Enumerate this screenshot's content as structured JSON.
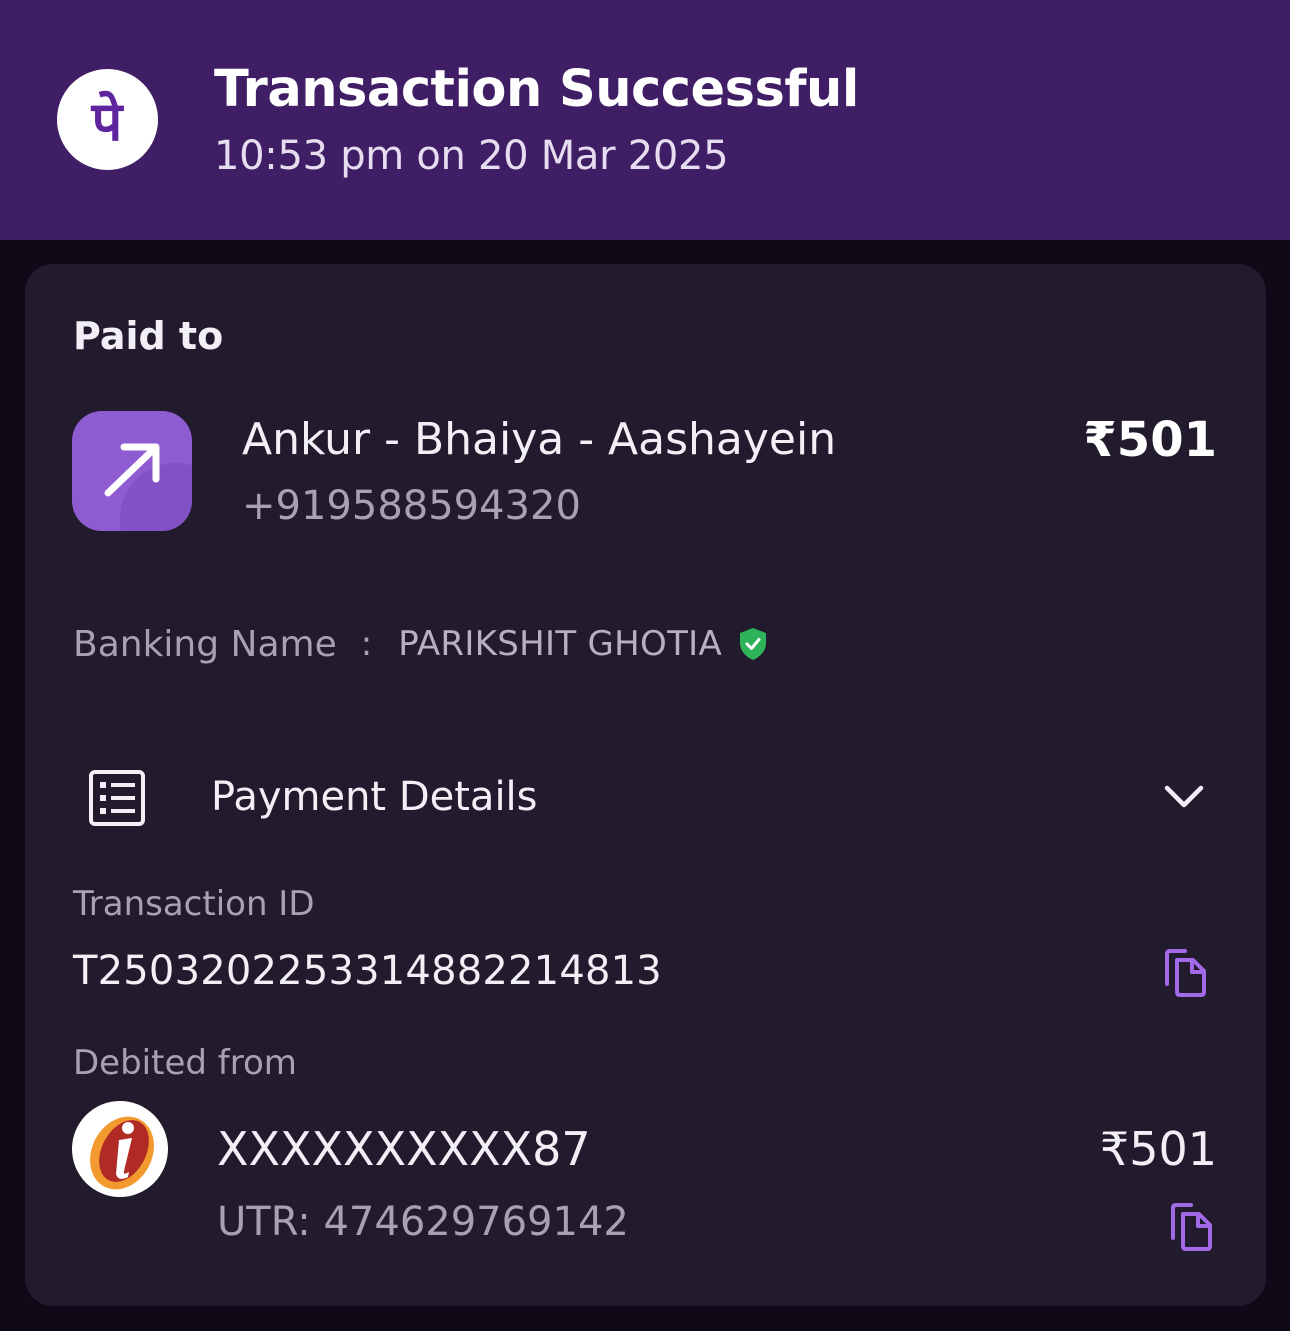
{
  "header": {
    "title": "Transaction Successful",
    "subtitle": "10:53 pm on 20 Mar 2025",
    "logo_glyph": "पे",
    "logo_icon": "phonepe-logo-icon",
    "background": "#401e65"
  },
  "paid_to": {
    "label": "Paid to",
    "name": "Ankur - Bhaiya - Aashayein",
    "phone": "+919588594320",
    "amount": "₹501",
    "icon": "arrow-up-right-icon",
    "icon_color": "#8f5bd0"
  },
  "banking": {
    "label": "Banking Name",
    "separator": ":",
    "value": "PARIKSHIT GHOTIA",
    "verified_icon": "verified-shield-icon",
    "verified_color": "#2fb35a"
  },
  "payment_details": {
    "label": "Payment Details",
    "icon": "receipt-list-icon",
    "toggle_icon": "chevron-down-icon",
    "transaction_id_label": "Transaction ID",
    "transaction_id": "T2503202253314882214813",
    "copy_icon": "copy-icon",
    "accent": "#a26ae8"
  },
  "debited_from": {
    "label": "Debited from",
    "bank_icon": "icici-bank-logo-icon",
    "account": "XXXXXXXXXX87",
    "amount": "₹501",
    "utr": "UTR: 474629769142"
  }
}
